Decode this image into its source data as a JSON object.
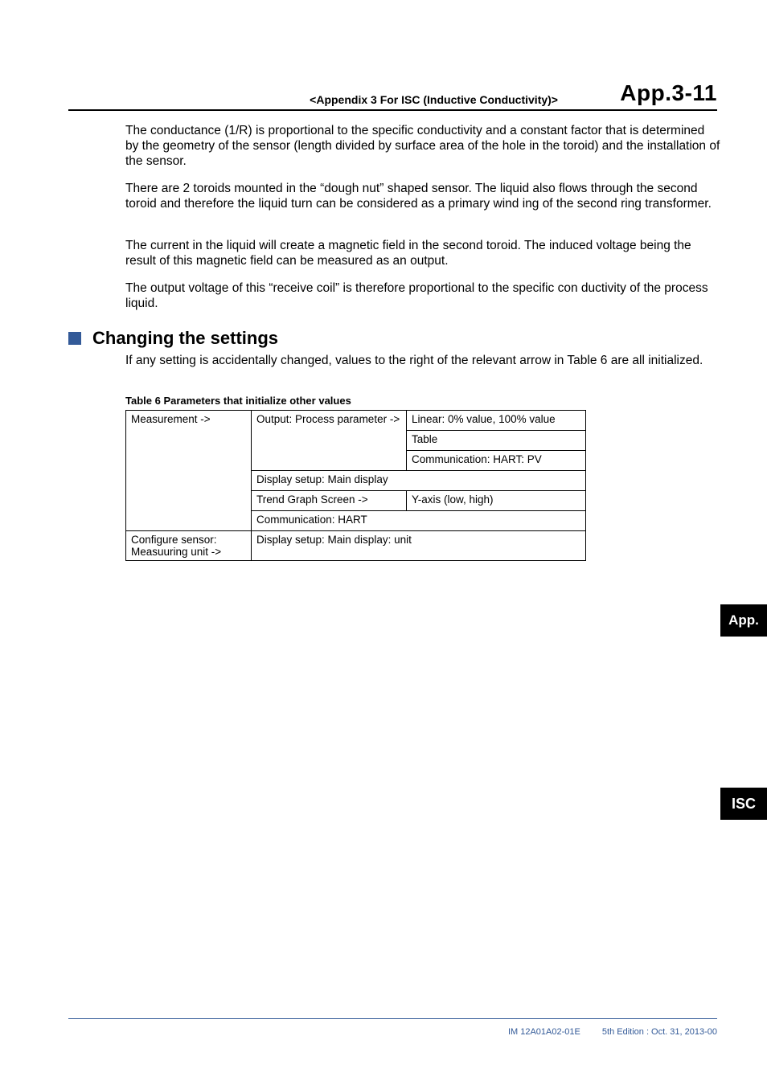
{
  "header": {
    "chapter": "<Appendix 3  For ISC (Inductive Conductivity)>",
    "page": "App.3-11"
  },
  "paragraphs": {
    "p1": "The conductance (1/R) is proportional to the specific conductivity and a constant factor that is determined by the geometry of the sensor (length divided by surface area of the hole in the toroid) and the installation of the sensor.",
    "p2": "There are 2 toroids mounted in the “dough nut” shaped sensor. The liquid also flows through the second toroid and therefore the liquid turn can be considered as a primary wind ing of the second ring transformer.",
    "p3": "The current in the liquid will create a magnetic field in the second toroid. The induced voltage being the result of this magnetic field can be measured as an output.",
    "p4": "The output voltage of this “receive coil” is therefore proportional to the specific con ductivity of the process liquid.",
    "section_heading": "Changing the settings",
    "p5": "If any setting is accidentally changed, values to the right of the relevant arrow in Table 6 are all initialized."
  },
  "table": {
    "caption": "Table 6  Parameters that initialize other values",
    "r1c1": "Measurement ->",
    "r1c2": "Output: Process parameter ->",
    "r1c3": "Linear: 0% value, 100% value",
    "r2c3": "Table",
    "r3c3": "Communication: HART: PV",
    "r4c2": "Display setup: Main display",
    "r5c2": "Trend Graph Screen ->",
    "r5c3": "Y-axis (low, high)",
    "r6c2": "Communication: HART",
    "r7c1": "Configure sensor: Measuuring unit ->",
    "r7c2": "Display setup: Main display: unit"
  },
  "tabs": {
    "app": "App.",
    "isc": "ISC"
  },
  "footer": {
    "doc": "IM 12A01A02-01E",
    "edition": "5th Edition : Oct. 31, 2013-00"
  }
}
